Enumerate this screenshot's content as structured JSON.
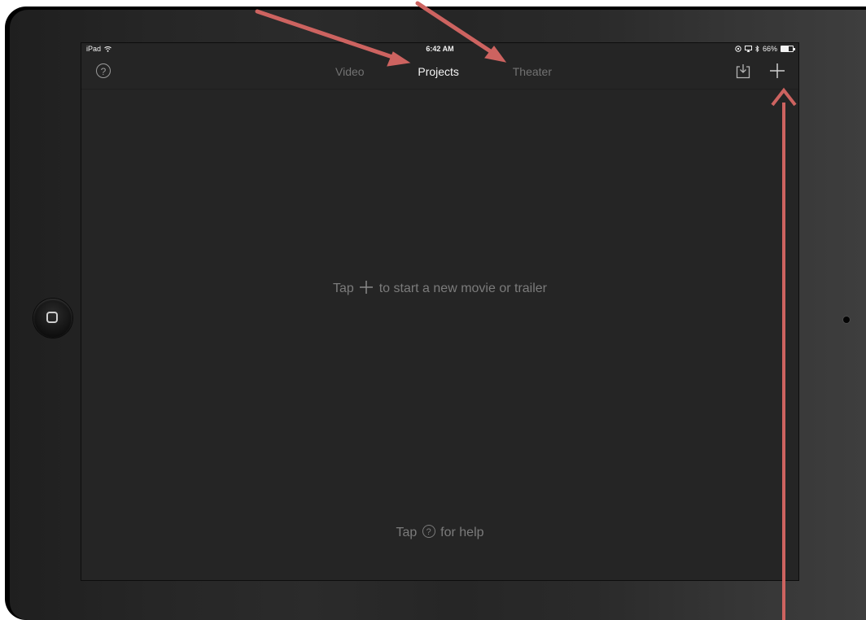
{
  "status_bar": {
    "device": "iPad",
    "time": "6:42 AM",
    "battery": "66%",
    "battery_level": 0.66
  },
  "nav": {
    "help_icon": "question-circle-icon",
    "tabs": [
      {
        "label": "Video",
        "active": false
      },
      {
        "label": "Projects",
        "active": true
      },
      {
        "label": "Theater",
        "active": false
      }
    ],
    "import_icon": "import-tray-icon",
    "add_icon": "plus-icon"
  },
  "empty_state": {
    "prefix": "Tap",
    "suffix": "to start a new movie or trailer"
  },
  "help_hint": {
    "prefix": "Tap",
    "suffix": "for help"
  },
  "annotations": {
    "arrow_color": "#cd6360"
  },
  "colors": {
    "screen_bg": "#252525",
    "active_tab": "#f4f4f4",
    "inactive_tab": "#727272"
  }
}
